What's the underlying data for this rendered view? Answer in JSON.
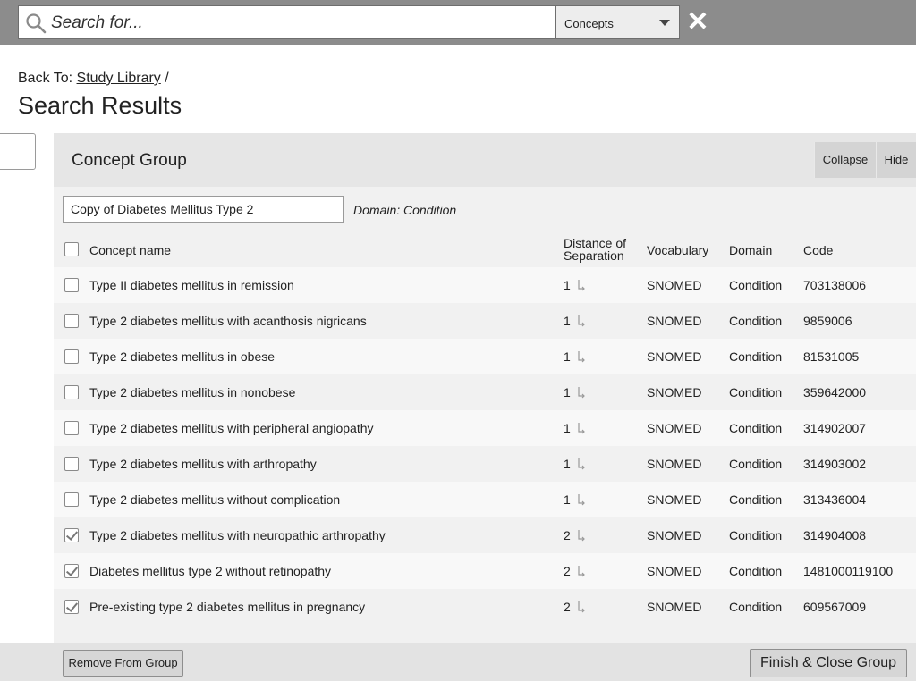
{
  "search": {
    "placeholder": "Search for...",
    "scope": "Concepts",
    "close_glyph": "✕"
  },
  "breadcrumb": {
    "prefix": "Back To:",
    "link": "Study Library",
    "separator": "/"
  },
  "page_title": "Search Results",
  "panel": {
    "title": "Concept Group",
    "collapse_label": "Collapse",
    "hide_label": "Hide",
    "group_name": "Copy of Diabetes Mellitus Type 2",
    "domain_note": "Domain: Condition"
  },
  "table": {
    "headers": {
      "name": "Concept name",
      "distance_1": "Distance of",
      "distance_2": "Separation",
      "vocabulary": "Vocabulary",
      "domain": "Domain",
      "code": "Code"
    },
    "rows": [
      {
        "name": "Type II diabetes mellitus in remission",
        "distance": "1",
        "vocabulary": "SNOMED",
        "domain": "Condition",
        "code": "703138006",
        "checked": false
      },
      {
        "name": "Type 2 diabetes mellitus with acanthosis nigricans",
        "distance": "1",
        "vocabulary": "SNOMED",
        "domain": "Condition",
        "code": "9859006",
        "checked": false
      },
      {
        "name": "Type 2 diabetes mellitus in obese",
        "distance": "1",
        "vocabulary": "SNOMED",
        "domain": "Condition",
        "code": "81531005",
        "checked": false
      },
      {
        "name": "Type 2 diabetes mellitus in nonobese",
        "distance": "1",
        "vocabulary": "SNOMED",
        "domain": "Condition",
        "code": "359642000",
        "checked": false
      },
      {
        "name": "Type 2 diabetes mellitus with peripheral angiopathy",
        "distance": "1",
        "vocabulary": "SNOMED",
        "domain": "Condition",
        "code": "314902007",
        "checked": false
      },
      {
        "name": "Type 2 diabetes mellitus with arthropathy",
        "distance": "1",
        "vocabulary": "SNOMED",
        "domain": "Condition",
        "code": "314903002",
        "checked": false
      },
      {
        "name": "Type 2 diabetes mellitus without complication",
        "distance": "1",
        "vocabulary": "SNOMED",
        "domain": "Condition",
        "code": "313436004",
        "checked": false
      },
      {
        "name": "Type 2 diabetes mellitus with neuropathic arthropathy",
        "distance": "2",
        "vocabulary": "SNOMED",
        "domain": "Condition",
        "code": "314904008",
        "checked": true
      },
      {
        "name": "Diabetes mellitus type 2 without retinopathy",
        "distance": "2",
        "vocabulary": "SNOMED",
        "domain": "Condition",
        "code": "1481000119100",
        "checked": true
      },
      {
        "name": "Pre-existing type 2 diabetes mellitus in pregnancy",
        "distance": "2",
        "vocabulary": "SNOMED",
        "domain": "Condition",
        "code": "609567009",
        "checked": true
      }
    ]
  },
  "footer": {
    "remove_label": "Remove From Group",
    "finish_label": "Finish & Close Group"
  },
  "icons": {
    "search": "search-icon",
    "close": "close-icon",
    "dropdown": "chevron-down-icon",
    "distance": "child-arrow-icon"
  }
}
